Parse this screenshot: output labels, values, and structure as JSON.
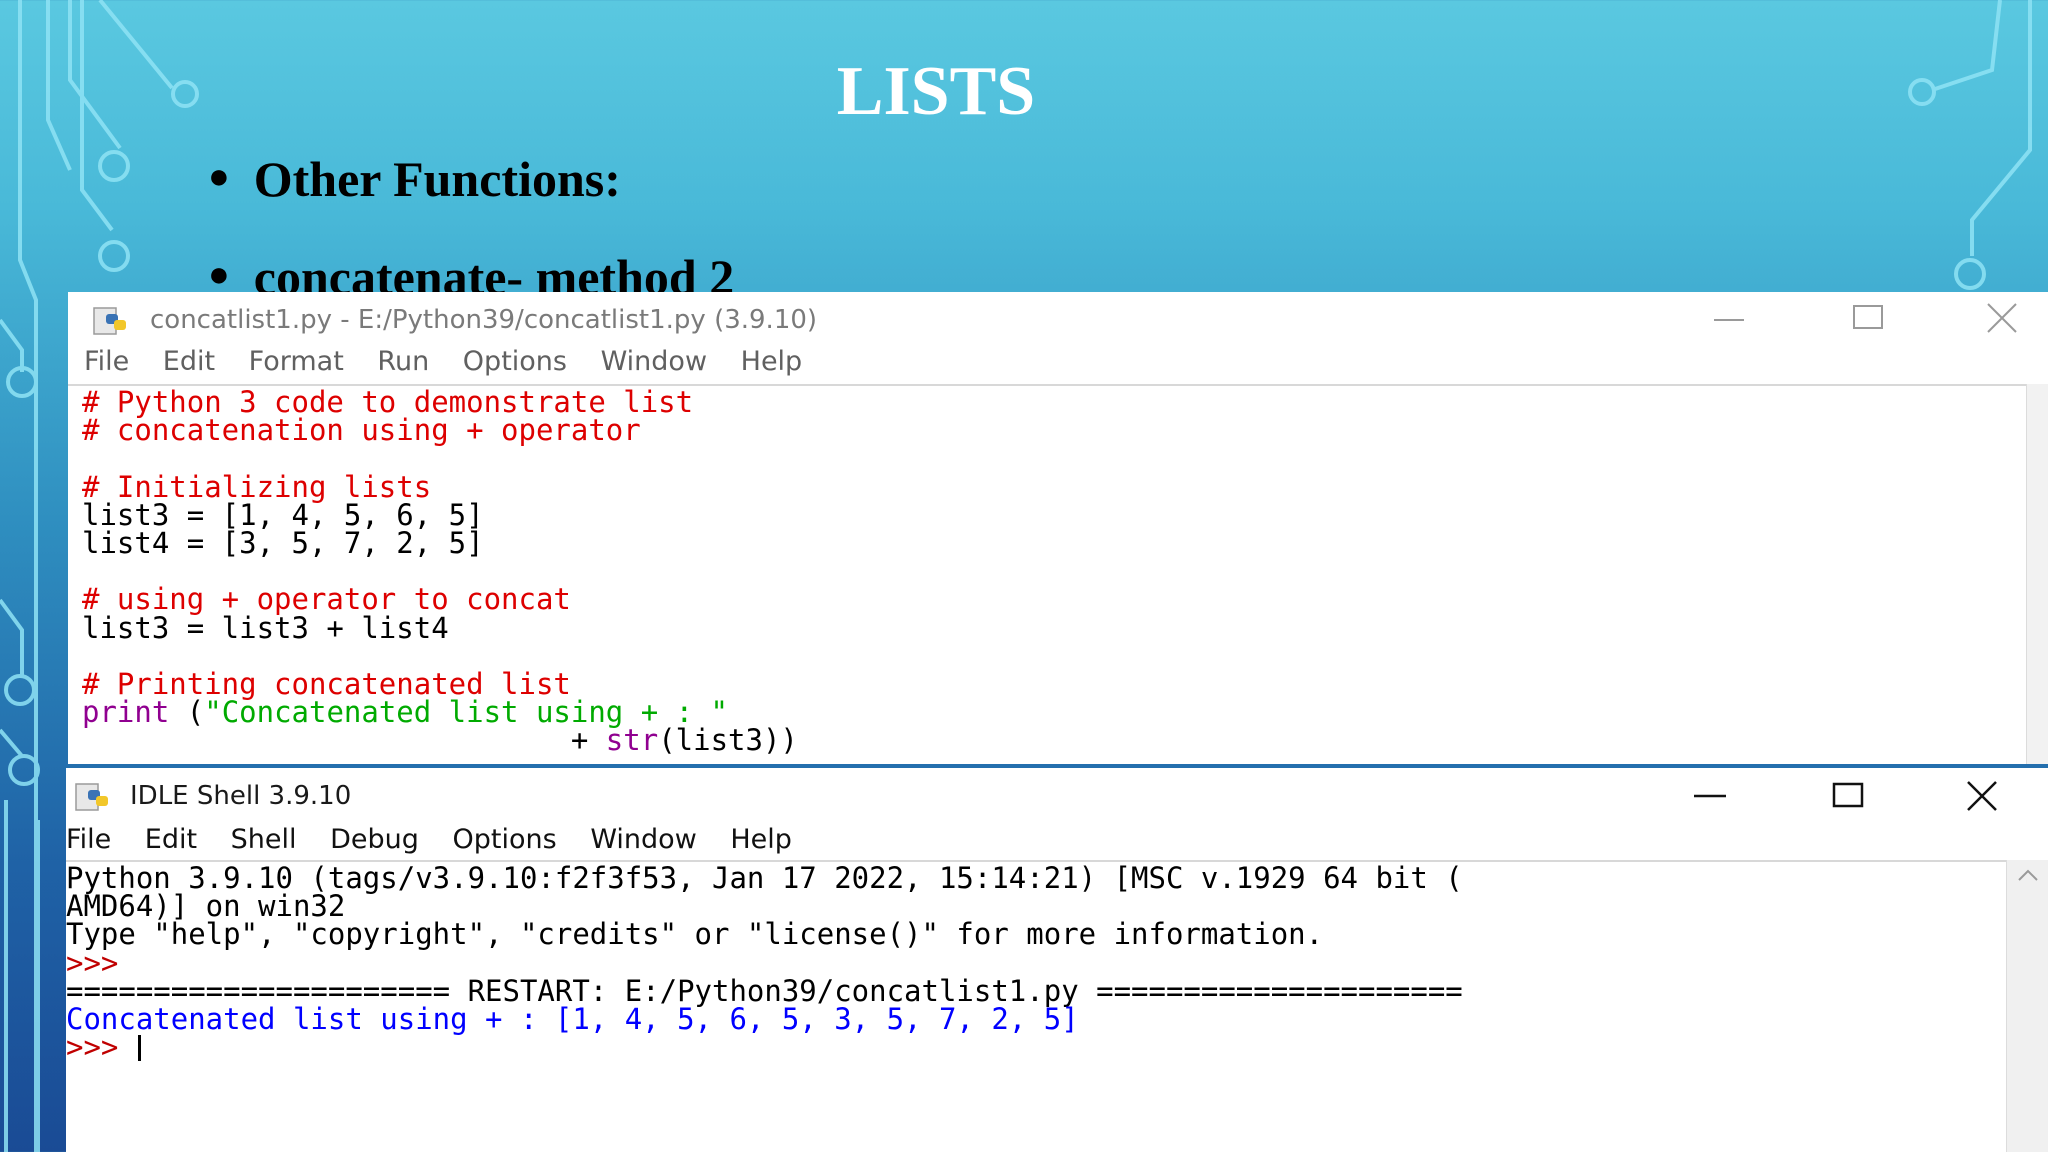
{
  "slide": {
    "title": "LISTS",
    "bullets": [
      "Other Functions:",
      "concatenate- method 2"
    ]
  },
  "editor": {
    "title": "concatlist1.py - E:/Python39/concatlist1.py (3.9.10)",
    "menu": [
      "File",
      "Edit",
      "Format",
      "Run",
      "Options",
      "Window",
      "Help"
    ],
    "code": {
      "l1": "# Python 3 code to demonstrate list",
      "l2": "# concatenation using + operator",
      "l4": "# Initializing lists",
      "l5": "list3 = [1, 4, 5, 6, 5]",
      "l6": "list4 = [3, 5, 7, 2, 5]",
      "l8": "# using + operator to concat",
      "l9": "list3 = list3 + list4",
      "l11": "# Printing concatenated list",
      "l12_kw": "print",
      "l12_mid": " (",
      "l12_str": "\"Concatenated list using + : \"",
      "l13_pre": "                            + ",
      "l13_kw": "str",
      "l13_post": "(list3))"
    }
  },
  "shell": {
    "title": "IDLE Shell 3.9.10",
    "menu": [
      "File",
      "Edit",
      "Shell",
      "Debug",
      "Options",
      "Window",
      "Help"
    ],
    "lines": {
      "l1": "Python 3.9.10 (tags/v3.9.10:f2f3f53, Jan 17 2022, 15:14:21) [MSC v.1929 64 bit (",
      "l2": "AMD64)] on win32",
      "l3": "Type \"help\", \"copyright\", \"credits\" or \"license()\" for more information.",
      "l4": ">>>",
      "l5": "====================== RESTART: E:/Python39/concatlist1.py =====================",
      "l6": "Concatenated list using + : [1, 4, 5, 6, 5, 3, 5, 7, 2, 5]",
      "l7": ">>> "
    }
  },
  "colors": {
    "comment": "#dd0000",
    "builtin": "#900090",
    "string": "#00aa00",
    "output": "#0000ff",
    "prompt": "#c00000"
  },
  "icons": [
    "python-file-icon",
    "minimize-icon",
    "maximize-icon",
    "close-icon"
  ]
}
